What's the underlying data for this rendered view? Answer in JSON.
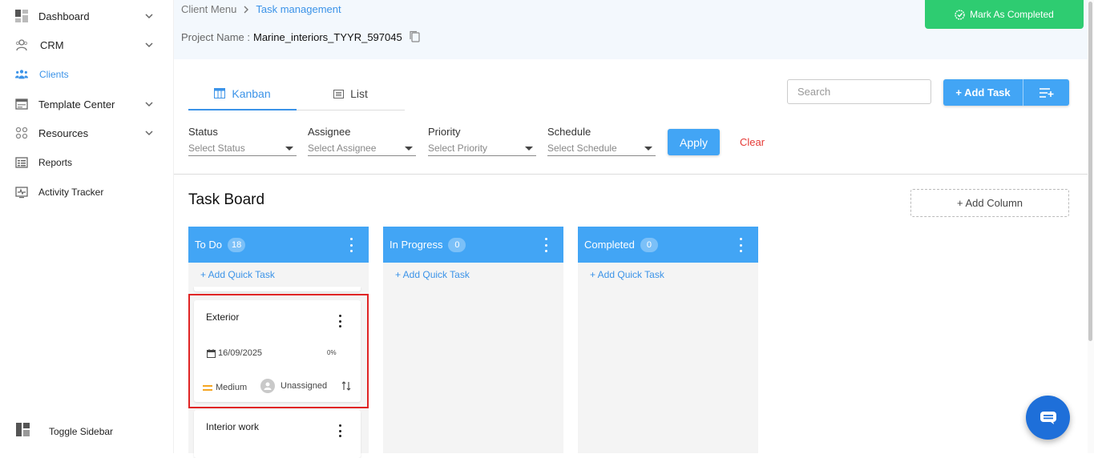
{
  "sidebar": {
    "items": [
      {
        "label": "Dashboard",
        "icon": "dashboard-icon",
        "has_chevron": true
      },
      {
        "label": "CRM",
        "icon": "crm-icon",
        "has_chevron": true
      },
      {
        "label": "Clients",
        "icon": "clients-icon",
        "has_chevron": false,
        "active": true
      },
      {
        "label": "Template Center",
        "icon": "template-icon",
        "has_chevron": true
      },
      {
        "label": "Resources",
        "icon": "resources-icon",
        "has_chevron": true
      },
      {
        "label": "Reports",
        "icon": "reports-icon",
        "has_chevron": false
      },
      {
        "label": "Activity Tracker",
        "icon": "activity-icon",
        "has_chevron": false
      }
    ],
    "toggle_label": "Toggle Sidebar"
  },
  "breadcrumb": {
    "first": "Client Menu",
    "second": "Task management"
  },
  "project": {
    "label": "Project Name :",
    "value": "Marine_interiors_TYYR_597045"
  },
  "mark_completed_label": "Mark As Completed",
  "tabs": {
    "kanban": "Kanban",
    "list": "List"
  },
  "search": {
    "placeholder": "Search"
  },
  "add_task_label": "+ Add Task",
  "filters": {
    "status": {
      "label": "Status",
      "placeholder": "Select Status"
    },
    "assignee": {
      "label": "Assignee",
      "placeholder": "Select Assignee"
    },
    "priority": {
      "label": "Priority",
      "placeholder": "Select Priority"
    },
    "schedule": {
      "label": "Schedule",
      "placeholder": "Select Schedule"
    },
    "apply": "Apply",
    "clear": "Clear"
  },
  "board": {
    "title": "Task Board",
    "add_column": "+ Add Column",
    "quick_task": "+ Add Quick Task",
    "columns": [
      {
        "name": "To Do",
        "count": "18"
      },
      {
        "name": "In Progress",
        "count": "0"
      },
      {
        "name": "Completed",
        "count": "0"
      }
    ],
    "cards": [
      {
        "title": "Exterior",
        "date": "16/09/2025",
        "progress": "0%",
        "priority": "Medium",
        "assignee": "Unassigned"
      },
      {
        "title": "Interior work"
      }
    ]
  },
  "colors": {
    "accent": "#42a5f5",
    "success": "#2ecc71",
    "danger": "#e53935",
    "priority_medium": "#f5a623"
  }
}
